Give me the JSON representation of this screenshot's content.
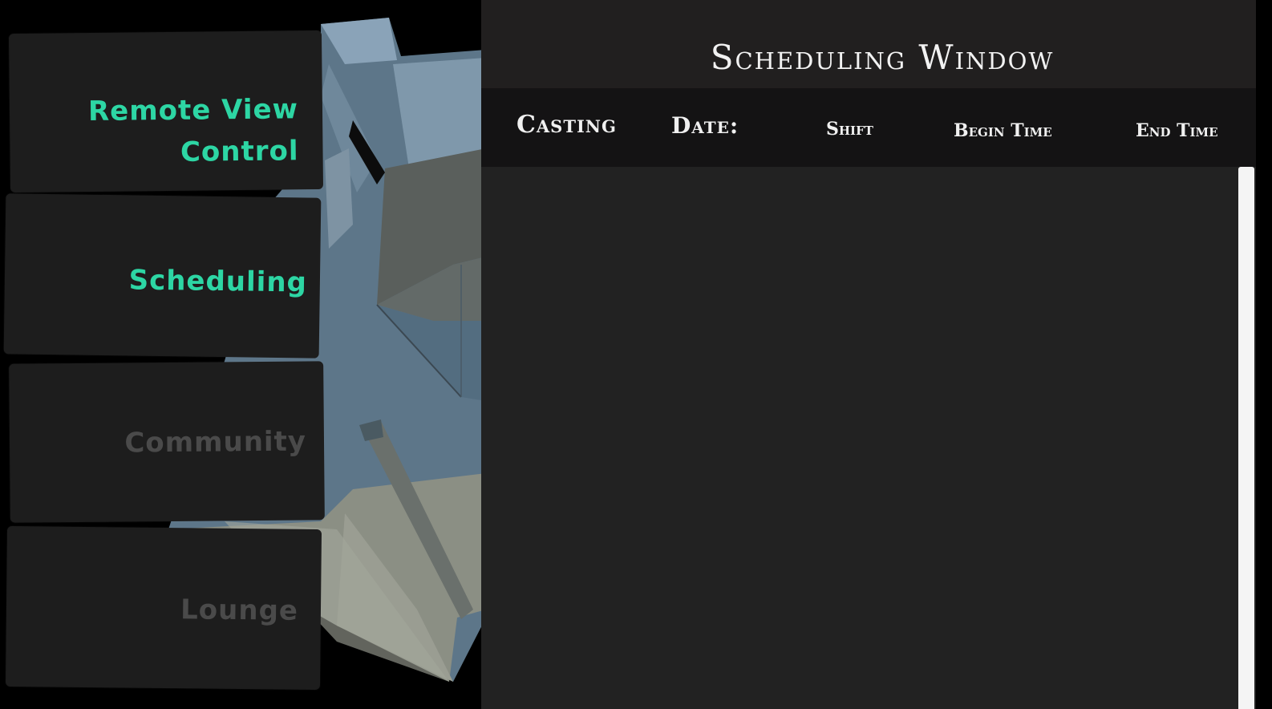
{
  "nav": {
    "items": [
      {
        "label_line1": "Remote View",
        "label_line2": "Control",
        "state": "active"
      },
      {
        "label": "Scheduling",
        "state": "active"
      },
      {
        "label": "Community",
        "state": "inactive"
      },
      {
        "label": "Lounge",
        "state": "inactive"
      }
    ]
  },
  "scheduling_window": {
    "title": "Scheduling Window",
    "columns": {
      "casting": "Casting",
      "date": "Date:",
      "shift": "Shift",
      "begin_time": "Begin Time",
      "end_time": "End Time"
    },
    "rows": []
  },
  "colors": {
    "accent": "#2dd6a4",
    "inactive_text": "#4a4a4a",
    "panel": "#1d1d1d",
    "window_bg": "#222222",
    "header_bg": "#141314",
    "scene_blue": "#5c7588"
  }
}
